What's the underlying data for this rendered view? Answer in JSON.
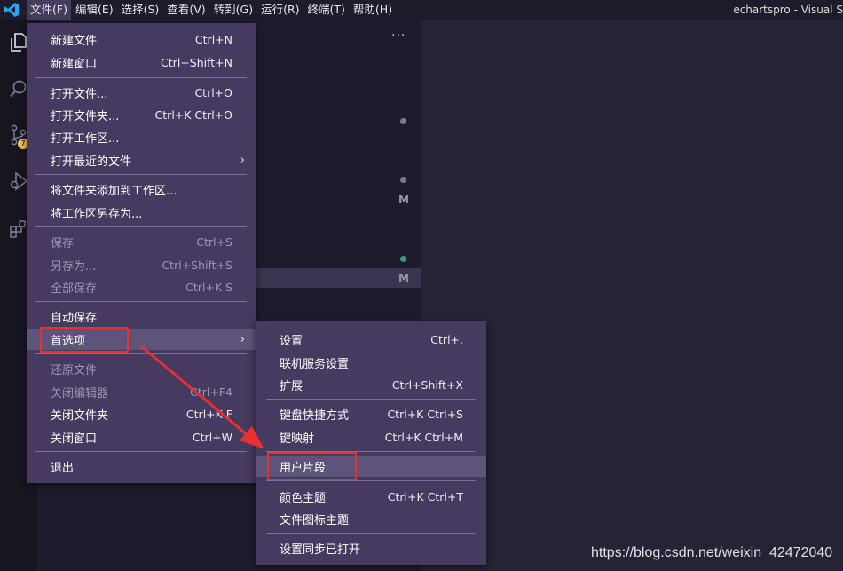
{
  "titlebar": {
    "menus": [
      "文件(F)",
      "编辑(E)",
      "选择(S)",
      "查看(V)",
      "转到(G)",
      "运行(R)",
      "终端(T)",
      "帮助(H)"
    ],
    "window_title": "echartspro - Visual S"
  },
  "activity": {
    "scm_badge": "7"
  },
  "sidebar": {
    "more": "···",
    "decorations": [
      "M",
      "M"
    ]
  },
  "file_menu": {
    "items": [
      {
        "label": "新建文件",
        "key": "Ctrl+N"
      },
      {
        "label": "新建窗口",
        "key": "Ctrl+Shift+N"
      },
      {
        "label": "打开文件...",
        "key": "Ctrl+O"
      },
      {
        "label": "打开文件夹...",
        "key": "Ctrl+K Ctrl+O"
      },
      {
        "label": "打开工作区...",
        "key": ""
      },
      {
        "label": "打开最近的文件",
        "key": ""
      },
      {
        "label": "将文件夹添加到工作区...",
        "key": ""
      },
      {
        "label": "将工作区另存为...",
        "key": ""
      },
      {
        "label": "保存",
        "key": "Ctrl+S"
      },
      {
        "label": "另存为...",
        "key": "Ctrl+Shift+S"
      },
      {
        "label": "全部保存",
        "key": "Ctrl+K S"
      },
      {
        "label": "自动保存",
        "key": ""
      },
      {
        "label": "首选项",
        "key": ""
      },
      {
        "label": "还原文件",
        "key": ""
      },
      {
        "label": "关闭编辑器",
        "key": "Ctrl+F4"
      },
      {
        "label": "关闭文件夹",
        "key": "Ctrl+K F"
      },
      {
        "label": "关闭窗口",
        "key": "Ctrl+W"
      },
      {
        "label": "退出",
        "key": ""
      }
    ]
  },
  "prefs_menu": {
    "items": [
      {
        "label": "设置",
        "key": "Ctrl+,"
      },
      {
        "label": "联机服务设置",
        "key": ""
      },
      {
        "label": "扩展",
        "key": "Ctrl+Shift+X"
      },
      {
        "label": "键盘快捷方式",
        "key": "Ctrl+K Ctrl+S"
      },
      {
        "label": "键映射",
        "key": "Ctrl+K Ctrl+M"
      },
      {
        "label": "用户片段",
        "key": ""
      },
      {
        "label": "颜色主题",
        "key": "Ctrl+K Ctrl+T"
      },
      {
        "label": "文件图标主题",
        "key": ""
      },
      {
        "label": "设置同步已打开",
        "key": ""
      }
    ]
  },
  "watermark": "https://blog.csdn.net/weixin_42472040",
  "colors": {
    "menu_bg": "#463a60",
    "highlight": "#e8302e",
    "vscode_blue": "#23a9f2"
  }
}
